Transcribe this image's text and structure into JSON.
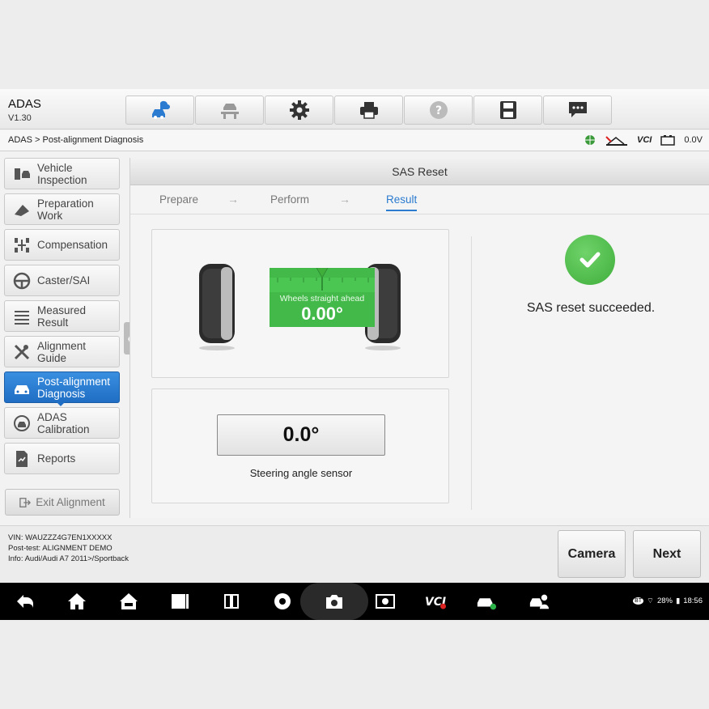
{
  "app": {
    "title": "ADAS",
    "version": "V1.30"
  },
  "toolbar": [
    {
      "icon": "car-cloud-icon",
      "name": "toolbar-home"
    },
    {
      "icon": "car-lift-icon",
      "name": "toolbar-lift"
    },
    {
      "icon": "gear-icon",
      "name": "toolbar-settings"
    },
    {
      "icon": "printer-icon",
      "name": "toolbar-print"
    },
    {
      "icon": "help-icon",
      "name": "toolbar-help"
    },
    {
      "icon": "save-icon",
      "name": "toolbar-save"
    },
    {
      "icon": "message-icon",
      "name": "toolbar-feedback"
    }
  ],
  "breadcrumb": "ADAS > Post-alignment Diagnosis",
  "status": {
    "vci": "VCI",
    "voltage": "0.0V"
  },
  "sidebar": {
    "items": [
      {
        "label": "Vehicle\nInspection",
        "icon": "vehicle-inspection-icon",
        "active": false
      },
      {
        "label": "Preparation\nWork",
        "icon": "preparation-icon",
        "active": false
      },
      {
        "label": "Compensation",
        "icon": "compensation-icon",
        "active": false
      },
      {
        "label": "Caster/SAI",
        "icon": "steering-wheel-icon",
        "active": false
      },
      {
        "label": "Measured\nResult",
        "icon": "list-icon",
        "active": false
      },
      {
        "label": "Alignment\nGuide",
        "icon": "tools-icon",
        "active": false
      },
      {
        "label": "Post-alignment\nDiagnosis",
        "icon": "car-icon",
        "active": true
      },
      {
        "label": "ADAS\nCalibration",
        "icon": "adas-icon",
        "active": false
      },
      {
        "label": "Reports",
        "icon": "report-icon",
        "active": false
      }
    ],
    "exit_label": "Exit Alignment"
  },
  "main": {
    "title": "SAS Reset",
    "steps": [
      "Prepare",
      "Perform",
      "Result"
    ],
    "active_step": 2,
    "gauge": {
      "label": "Wheels straight ahead",
      "value": "0.00°"
    },
    "sensor": {
      "value": "0.0°",
      "label": "Steering angle sensor"
    },
    "result_message": "SAS reset succeeded."
  },
  "footer": {
    "vin": "VIN: WAUZZZ4G7EN1XXXXX",
    "post_test": "Post-test: ALIGNMENT DEMO",
    "info": "Info: Audi/Audi A7 2011>/Sportback",
    "camera_label": "Camera",
    "next_label": "Next"
  },
  "system": {
    "battery": "28%",
    "time": "18:56",
    "bt": "BT"
  },
  "colors": {
    "accent": "#2b7bd0",
    "success": "#43b94a",
    "active_sidebar": "#1f6ec4"
  }
}
